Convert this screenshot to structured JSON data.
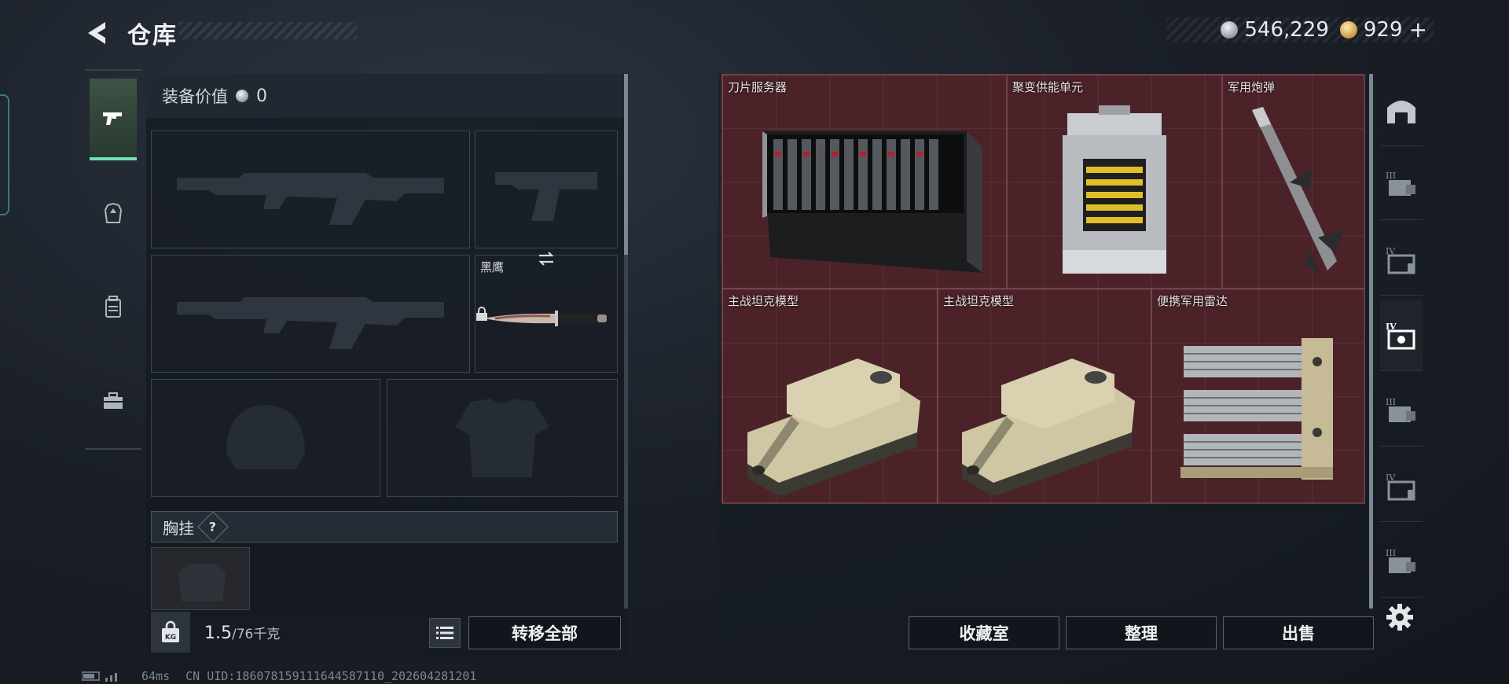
{
  "header": {
    "title": "仓库",
    "currency_silver": "546,229",
    "currency_gold": "929",
    "plus_label": "+"
  },
  "left_nav": {
    "items": [
      {
        "name": "pistol-icon",
        "active": true
      },
      {
        "name": "armor-icon",
        "active": false
      },
      {
        "name": "backpack-icon",
        "active": false
      },
      {
        "name": "toolbox-icon",
        "active": false
      }
    ]
  },
  "equipment": {
    "value_label": "装备价值",
    "value": "0",
    "knife_name": "黑鹰",
    "chest_rig_label": "胸挂",
    "help_label": "?"
  },
  "footer_left": {
    "weight_icon_label": "KG",
    "weight_current": "1.5",
    "weight_max": "/76千克",
    "transfer_all": "转移全部"
  },
  "stash": {
    "items": [
      {
        "label": "刀片服务器"
      },
      {
        "label": "聚变供能单元"
      },
      {
        "label": "军用炮弹"
      },
      {
        "label": "主战坦克模型"
      },
      {
        "label": "主战坦克模型"
      },
      {
        "label": "便携军用雷达"
      }
    ],
    "buttons": {
      "collection": "收藏室",
      "organize": "整理",
      "sell": "出售"
    }
  },
  "right_rail": {
    "items": [
      "III",
      "IV",
      "IV",
      "III",
      "IV",
      "III"
    ]
  },
  "status": {
    "ping": "64ms",
    "uid": "CN UID:186078159111644587110_202604281201"
  },
  "colors": {
    "accent": "#6fe3b2",
    "stash_bg": "#4c2229",
    "panel": "#1a1f27"
  }
}
